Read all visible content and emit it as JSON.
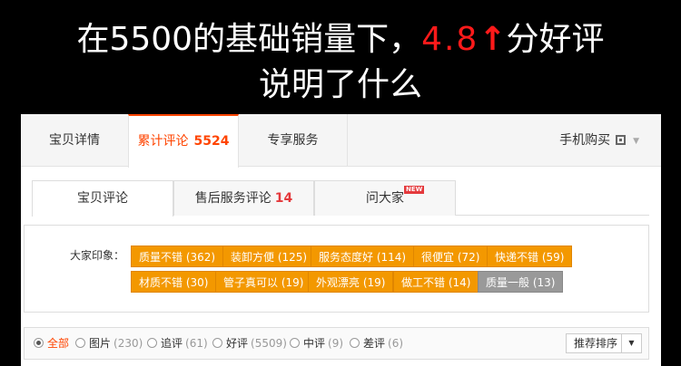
{
  "headline": {
    "line1_before": "在5500的基础销量下，",
    "line1_rating": "4.8",
    "line1_arrow": "↑",
    "line1_after": "分好评",
    "line2": "说明了什么"
  },
  "tabs": {
    "details": "宝贝详情",
    "reviews_label": "累计评论",
    "reviews_count": "5524",
    "exclusive": "专享服务",
    "mobile_buy": "手机购买"
  },
  "subtabs": {
    "item_reviews": "宝贝评论",
    "aftersales_label": "售后服务评论",
    "aftersales_count": "14",
    "ask": "问大家",
    "new_badge": "NEW"
  },
  "impressions": {
    "label": "大家印象：",
    "tags": [
      {
        "text": "质量不错 (362)"
      },
      {
        "text": "装卸方便 (125)"
      },
      {
        "text": "服务态度好 (114)"
      },
      {
        "text": "很便宜 (72)"
      },
      {
        "text": "快递不错 (59)"
      },
      {
        "text": "材质不错 (30)"
      },
      {
        "text": "管子真可以 (19)"
      },
      {
        "text": "外观漂亮 (19)"
      },
      {
        "text": "做工不错 (14)"
      },
      {
        "text": "质量一般 (13)"
      }
    ]
  },
  "filters": [
    {
      "label": "全部",
      "count": ""
    },
    {
      "label": "图片",
      "count": "(230)"
    },
    {
      "label": "追评",
      "count": "(61)"
    },
    {
      "label": "好评",
      "count": "(5509)"
    },
    {
      "label": "中评",
      "count": "(9)"
    },
    {
      "label": "差评",
      "count": "(6)"
    }
  ],
  "sort": {
    "value": "推荐排序",
    "arrow": "▼"
  },
  "colors": {
    "accent": "#ff4400",
    "tag": "#f39800",
    "tag_negative": "#999999",
    "headline_red": "#ff1a1a"
  }
}
